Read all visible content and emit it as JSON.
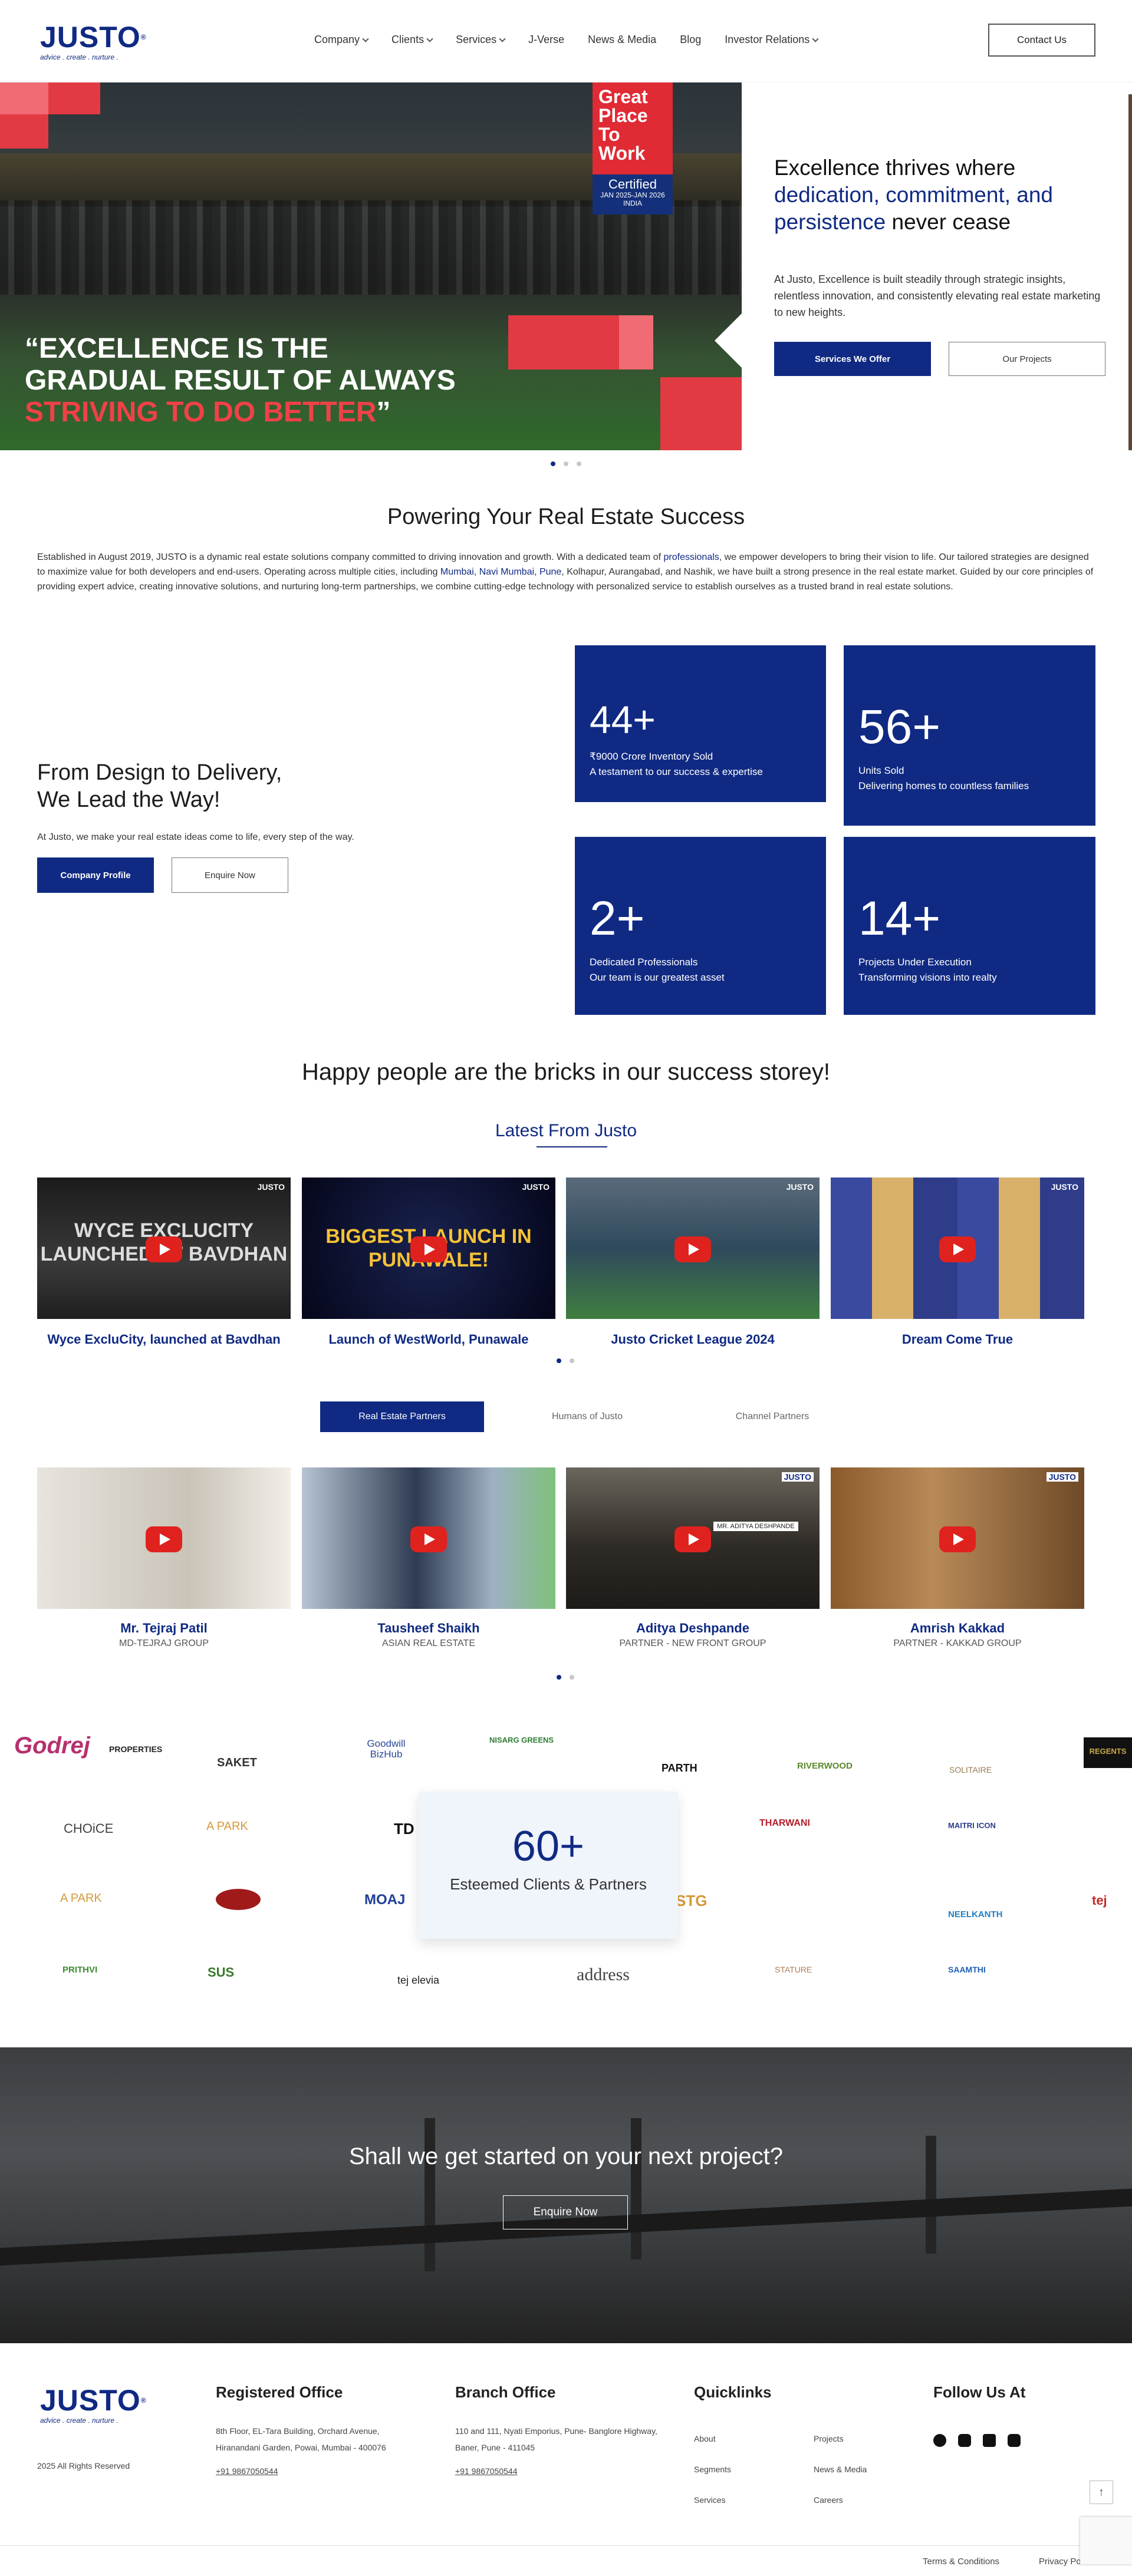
{
  "brand": {
    "name": "JUSTO",
    "tagline": "advice . create . nurture .",
    "reg": "®"
  },
  "nav": [
    {
      "label": "Company",
      "dropdown": true
    },
    {
      "label": "Clients",
      "dropdown": true
    },
    {
      "label": "Services",
      "dropdown": true
    },
    {
      "label": "J-Verse",
      "dropdown": false
    },
    {
      "label": "News & Media",
      "dropdown": false
    },
    {
      "label": "Blog",
      "dropdown": false
    },
    {
      "label": "Investor Relations",
      "dropdown": true
    }
  ],
  "contact_label": "Contact Us",
  "hero": {
    "quote_l1": "“EXCELLENCE IS THE",
    "quote_l2": "GRADUAL RESULT OF ALWAYS",
    "quote_l3": "STRIVING TO DO BETTER",
    "quote_end": "”",
    "badge": {
      "title": "Great Place To Work",
      "certified": "Certified",
      "dates": "JAN 2025-JAN 2026",
      "country": "INDIA"
    },
    "h_a": "Excellence thrives where",
    "h_b": "dedication, commitment, and persistence",
    "h_c": "never cease",
    "body": "At Justo, Excellence is built steadily through strategic insights, relentless innovation, and consistently elevating real estate marketing to new heights.",
    "btn_primary": "Services We Offer",
    "btn_secondary": "Our Projects"
  },
  "powering": {
    "title": "Powering Your Real Estate Success",
    "p1": "Established in August 2019, JUSTO is a dynamic real estate solutions company committed to driving innovation and growth. With a dedicated team of ",
    "link1": "professionals",
    "p2": ", we empower developers to bring their vision to life. Our tailored strategies are designed to maximize value for both developers and end-users. Operating across multiple cities, including ",
    "link2": "Mumbai, Navi Mumbai, Pune",
    "p3": ", Kolhapur, Aurangabad, and Nashik, we have built a strong presence in the real estate market. Guided by our core principles of providing expert advice, creating innovative solutions, and nurturing long-term partnerships, we combine cutting-edge technology with personalized service to establish ourselves as a trusted brand in real estate solutions."
  },
  "design": {
    "h1": "From Design to Delivery,",
    "h2": "We Lead the Way!",
    "p": "At Justo, we make your real estate ideas come to life, every step of the way.",
    "btn_primary": "Company Profile",
    "btn_secondary": "Enquire Now"
  },
  "stats": [
    {
      "n": "44+",
      "l1": "₹9000 Crore Inventory Sold",
      "l2": "A testament to our success & expertise"
    },
    {
      "n": "56+",
      "l1": "Units Sold",
      "l2": "Delivering homes to countless families"
    },
    {
      "n": "2+",
      "l1": "Dedicated Professionals",
      "l2": "Our team is our greatest asset"
    },
    {
      "n": "14+",
      "l1": "Projects Under Execution",
      "l2": "Transforming visions into realty"
    }
  ],
  "happy": "Happy people are the bricks in our success storey!",
  "latest": {
    "title": "Latest From Justo",
    "cards": [
      {
        "title": "Wyce ExcluCity, launched at Bavdhan",
        "overlay": "WYCE EXCLUCITY LAUNCHED AT BAVDHAN"
      },
      {
        "title": "Launch of WestWorld, Punawale",
        "overlay": "BIGGEST LAUNCH IN PUNAWALE!"
      },
      {
        "title": "Justo Cricket League 2024",
        "overlay": ""
      },
      {
        "title": "Dream Come True",
        "overlay": ""
      }
    ],
    "thumb_logo": "JUSTO"
  },
  "partner_tabs": [
    "Real Estate Partners",
    "Humans of Justo",
    "Channel Partners"
  ],
  "partners": [
    {
      "name": "Mr. Tejraj Patil",
      "role": "MD-TEJRAJ GROUP"
    },
    {
      "name": "Tausheef Shaikh",
      "role": "ASIAN REAL ESTATE"
    },
    {
      "name": "Aditya Deshpande",
      "role": "PARTNER - NEW FRONT GROUP",
      "tag": "MR. ADITYA DESHPANDE"
    },
    {
      "name": "Amrish Kakkad",
      "role": "PARTNER - KAKKAD GROUP"
    }
  ],
  "logos": {
    "row1": [
      "Godrej",
      "PROPERTIES",
      "SAKET",
      "Goodwill BizHub",
      "NISARG GREENS",
      "PARTH",
      "RIVERWOOD",
      "SOLITAIRE",
      "REGENTS"
    ],
    "row2": [
      "CHOiCE",
      "A PARK",
      "TD",
      "THARWANI",
      "MAITRI ICON"
    ],
    "row3": [
      "A PARK",
      "MOAJ",
      "STG",
      "NEELKANTH",
      "tej"
    ],
    "row4": [
      "PRITHVI",
      "SUS",
      "tej elevia",
      "address",
      "STATURE",
      "SAAMTHI"
    ]
  },
  "counter": {
    "n": "60+",
    "l": "Esteemed Clients & Partners"
  },
  "cta": {
    "title": "Shall we get started on your next project?",
    "btn": "Enquire Now"
  },
  "footer": {
    "rights": "2025 All Rights Reserved",
    "reg_title": "Registered Office",
    "reg_addr1": "8th Floor, EL-Tara Building, Orchard Avenue,",
    "reg_addr2": "Hiranandani Garden, Powai, Mumbai - 400076",
    "reg_phone": "+91 9867050544",
    "br_title": "Branch Office",
    "br_addr1": "110 and 111, Nyati Emporius, Pune- Banglore Highway,",
    "br_addr2": "Baner, Pune - 411045",
    "br_phone": "+91 9867050544",
    "ql_title": "Quicklinks",
    "links": [
      "About",
      "Projects",
      "Segments",
      "News & Media",
      "Services",
      "Careers"
    ],
    "follow": "Follow Us At",
    "terms": "Terms & Conditions",
    "privacy": "Privacy Po"
  }
}
